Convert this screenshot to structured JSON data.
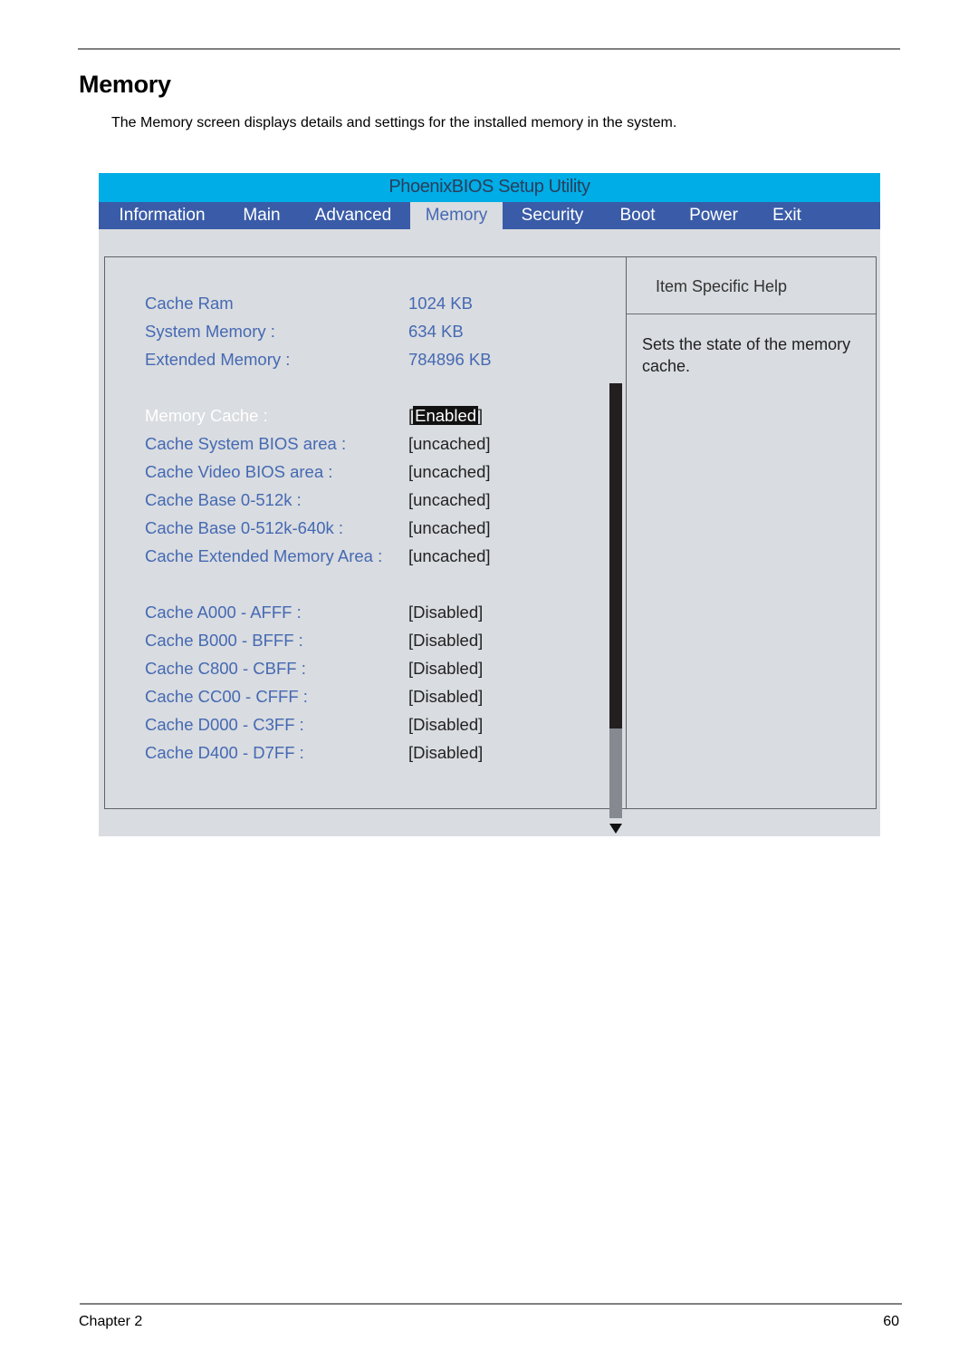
{
  "document": {
    "heading": "Memory",
    "description": "The Memory screen displays details and settings for the installed memory in the system.",
    "footer": {
      "chapter": "Chapter 2",
      "page_number": "60"
    }
  },
  "bios": {
    "title": "PhoenixBIOS Setup Utility",
    "menu": [
      {
        "label": "Information",
        "active": false
      },
      {
        "label": "Main",
        "active": false
      },
      {
        "label": "Advanced",
        "active": false
      },
      {
        "label": "Memory",
        "active": true
      },
      {
        "label": "Security",
        "active": false
      },
      {
        "label": "Boot",
        "active": false
      },
      {
        "label": "Power",
        "active": false
      },
      {
        "label": "Exit",
        "active": false
      }
    ],
    "info_rows": [
      {
        "label": "Cache Ram",
        "value": "1024  KB"
      },
      {
        "label": "System Memory :",
        "value": "634  KB"
      },
      {
        "label": "Extended Memory :",
        "value": "784896  KB"
      }
    ],
    "settings": [
      {
        "label": "Memory Cache :",
        "value": "Enabled",
        "selected": true
      },
      {
        "label": "Cache System BIOS area :",
        "value": "[uncached]"
      },
      {
        "label": "Cache Video BIOS area :",
        "value": "[uncached]"
      },
      {
        "label": "Cache Base 0-512k :",
        "value": "[uncached]"
      },
      {
        "label": "Cache Base 0-512k-640k :",
        "value": "[uncached]"
      },
      {
        "label": "Cache Extended Memory Area :",
        "value": "[uncached]"
      }
    ],
    "region_settings": [
      {
        "label": "Cache A000 - AFFF :",
        "value": "[Disabled]"
      },
      {
        "label": "Cache B000 - BFFF :",
        "value": "[Disabled]"
      },
      {
        "label": "Cache C800 - CBFF :",
        "value": "[Disabled]"
      },
      {
        "label": "Cache CC00 - CFFF :",
        "value": "[Disabled]"
      },
      {
        "label": "Cache D000 - C3FF :",
        "value": "[Disabled]"
      },
      {
        "label": "Cache D400 - D7FF :",
        "value": "[Disabled]"
      }
    ],
    "help": {
      "title": "Item Specific Help",
      "text": "Sets the state of the memory cache."
    },
    "colors": {
      "title_bar": "#00ade6",
      "menu_bar": "#3a5ca8",
      "panel_bg": "#d9dce0",
      "label_blue": "#4569b3"
    }
  }
}
